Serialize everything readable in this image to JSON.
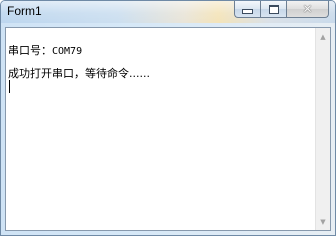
{
  "window": {
    "title": "Form1"
  },
  "titlebar": {
    "minimize_icon": "minimize-icon",
    "maximize_icon": "maximize-icon",
    "close_icon": "close-icon",
    "close_glyph": "✕"
  },
  "output": {
    "line1": "串口号：COM79",
    "line1_label": "串口号：",
    "line1_value": "COM79",
    "line2": "成功打开串口，等待命令......"
  },
  "scrollbar": {
    "up_arrow": "▲",
    "down_arrow": "▼"
  }
}
